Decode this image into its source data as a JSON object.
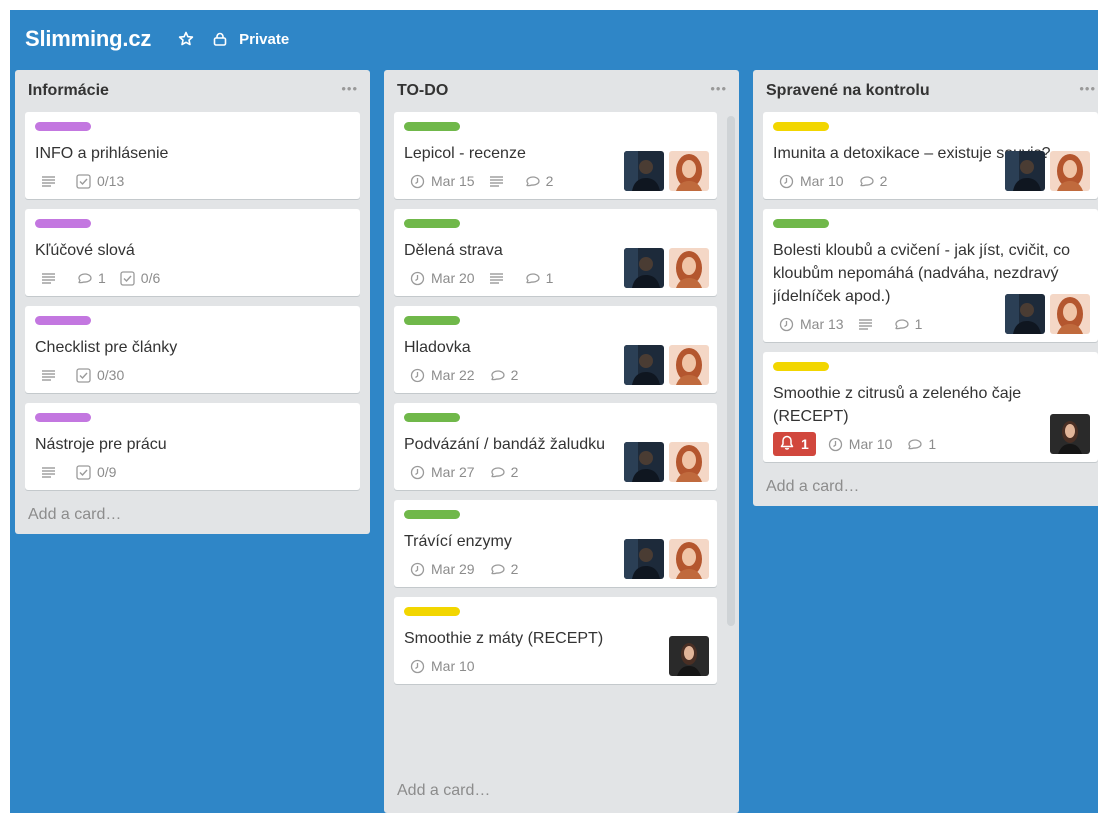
{
  "board": {
    "title": "Slimming.cz",
    "privacy": "Private"
  },
  "colors": {
    "board_bg": "#2f86c7",
    "label_purple": "#c377e0",
    "label_green": "#70b84a",
    "label_yellow": "#f2d600",
    "alert_red": "#d1473d"
  },
  "icons": {
    "star": "star-icon",
    "lock": "lock-icon",
    "description": "description-icon",
    "checklist": "checklist-icon",
    "comment": "comment-icon",
    "clock": "clock-icon",
    "bell": "bell-icon",
    "menu": "more-icon"
  },
  "add_card_label": "Add a card…",
  "lists": [
    {
      "title": "Informácie",
      "cards": [
        {
          "label": "purple",
          "title": "INFO a prihlásenie",
          "description": true,
          "checklist": "0/13"
        },
        {
          "label": "purple",
          "title": "Kľúčové slová",
          "description": true,
          "comments": "1",
          "checklist": "0/6"
        },
        {
          "label": "purple",
          "title": "Checklist pre články",
          "description": true,
          "checklist": "0/30"
        },
        {
          "label": "purple",
          "title": "Nástroje pre prácu",
          "description": true,
          "checklist": "0/9"
        }
      ]
    },
    {
      "title": "TO-DO",
      "cards": [
        {
          "label": "green",
          "title": "Lepicol - recenze",
          "due": "Mar 15",
          "description": true,
          "comments": "2",
          "members": 2
        },
        {
          "label": "green",
          "title": "Dělená strava",
          "due": "Mar 20",
          "description": true,
          "comments": "1",
          "members": 2
        },
        {
          "label": "green",
          "title": "Hladovka",
          "due": "Mar 22",
          "comments": "2",
          "members": 2
        },
        {
          "label": "green",
          "title": "Podvázání / bandáž žaludku",
          "due": "Mar 27",
          "comments": "2",
          "members": 2
        },
        {
          "label": "green",
          "title": "Trávící enzymy",
          "due": "Mar 29",
          "comments": "2",
          "members": 2
        },
        {
          "label": "yellow",
          "title": "Smoothie z máty (RECEPT)",
          "due": "Mar 10",
          "members": 1
        }
      ]
    },
    {
      "title": "Spravené na kontrolu",
      "cards": [
        {
          "label": "yellow",
          "title": "Imunita a detoxikace – existuje souvis?",
          "due": "Mar 10",
          "comments": "2",
          "members": 2
        },
        {
          "label": "green",
          "title": "Bolesti kloubů a cvičení - jak jíst, cvičit, co kloubům nepomáhá (nadváha, nezdravý jídelníček apod.)",
          "due": "Mar 13",
          "description": true,
          "comments": "1",
          "members": 2
        },
        {
          "label": "yellow",
          "title": "Smoothie z citrusů a zeleného čaje (RECEPT)",
          "alert": "1",
          "due": "Mar 10",
          "comments": "1",
          "members": 1
        }
      ]
    }
  ]
}
